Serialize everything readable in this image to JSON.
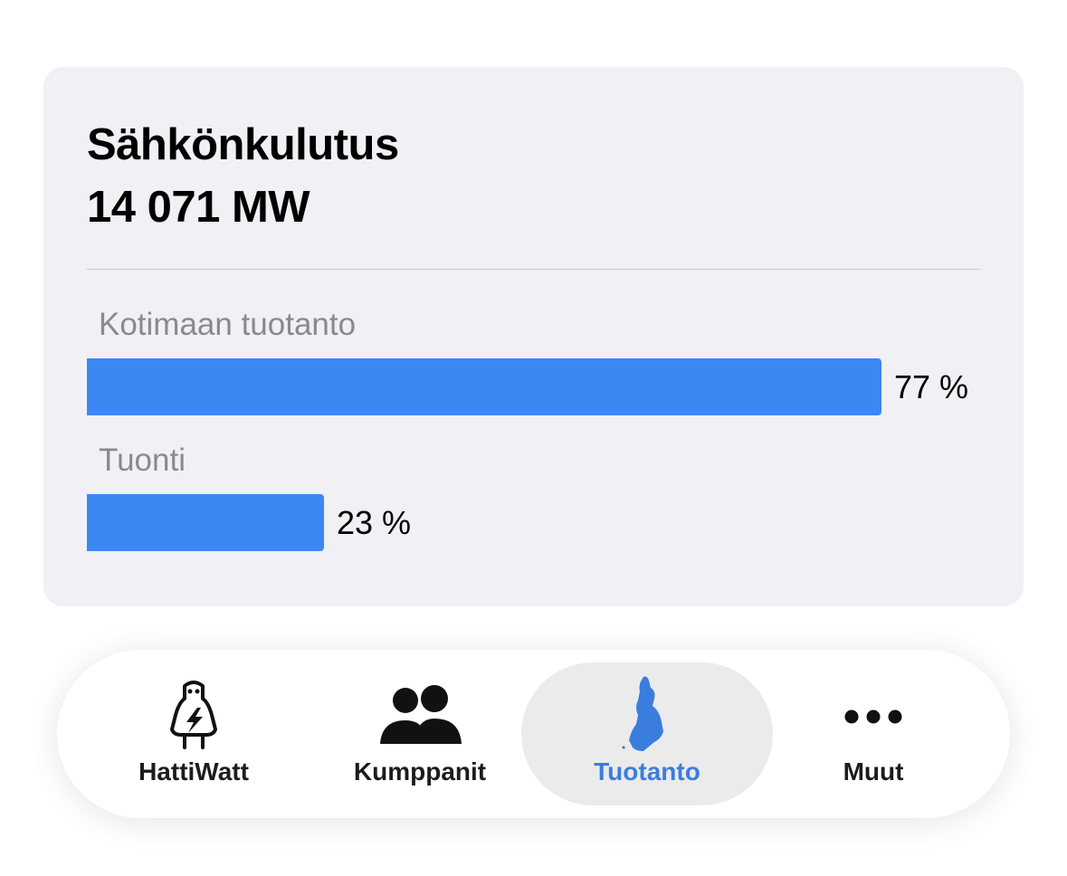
{
  "card": {
    "title": "Sähkönkulutus",
    "value": "14 071 MW",
    "rows": [
      {
        "label": "Kotimaan tuotanto",
        "percent": 77,
        "percent_label": "77 %"
      },
      {
        "label": "Tuonti",
        "percent": 23,
        "percent_label": "23 %"
      }
    ],
    "bar_color": "#3b88f3"
  },
  "tabbar": {
    "tabs": [
      {
        "label": "HattiWatt",
        "icon": "hattiwatt-mascot-icon",
        "active": false
      },
      {
        "label": "Kumppanit",
        "icon": "people-icon",
        "active": false
      },
      {
        "label": "Tuotanto",
        "icon": "finland-map-icon",
        "active": true
      },
      {
        "label": "Muut",
        "icon": "ellipsis-icon",
        "active": false
      }
    ],
    "active_color": "#3b7ddd"
  }
}
